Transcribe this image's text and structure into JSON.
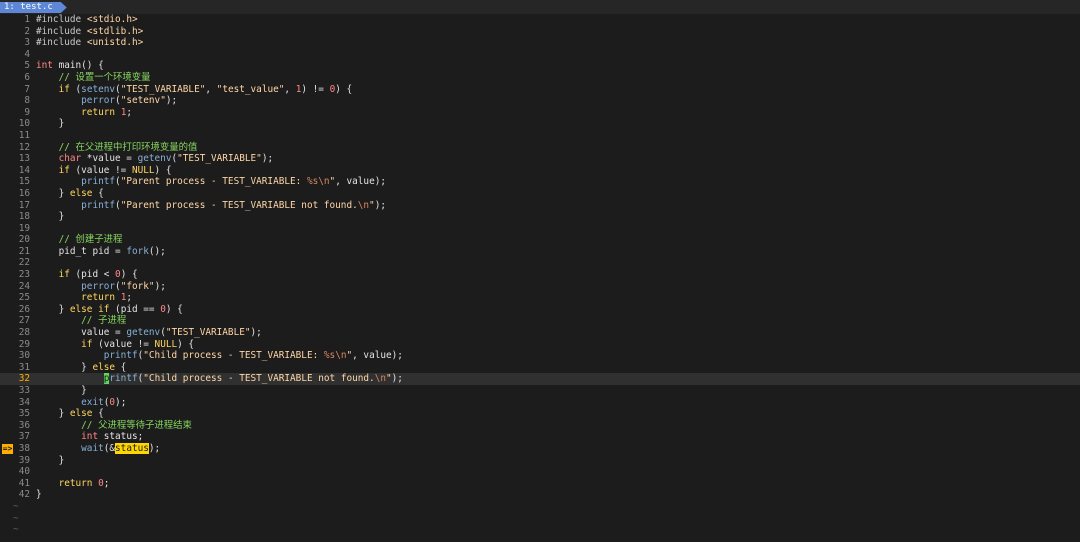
{
  "tab": {
    "label": "1: test.c"
  },
  "editor": {
    "lines": [
      {
        "n": "1",
        "code": "#include <stdio.h>"
      },
      {
        "n": "2",
        "code": "#include <stdlib.h>"
      },
      {
        "n": "3",
        "code": "#include <unistd.h>"
      },
      {
        "n": "4",
        "code": ""
      },
      {
        "n": "5",
        "code": "int main() {"
      },
      {
        "n": "6",
        "code": "    // 设置一个环境变量"
      },
      {
        "n": "7",
        "code": "    if (setenv(\"TEST_VARIABLE\", \"test_value\", 1) != 0) {"
      },
      {
        "n": "8",
        "code": "        perror(\"setenv\");"
      },
      {
        "n": "9",
        "code": "        return 1;"
      },
      {
        "n": "10",
        "code": "    }"
      },
      {
        "n": "11",
        "code": ""
      },
      {
        "n": "12",
        "code": "    // 在父进程中打印环境变量的值"
      },
      {
        "n": "13",
        "code": "    char *value = getenv(\"TEST_VARIABLE\");"
      },
      {
        "n": "14",
        "code": "    if (value != NULL) {"
      },
      {
        "n": "15",
        "code": "        printf(\"Parent process - TEST_VARIABLE: %s\\n\", value);"
      },
      {
        "n": "16",
        "code": "    } else {"
      },
      {
        "n": "17",
        "code": "        printf(\"Parent process - TEST_VARIABLE not found.\\n\");"
      },
      {
        "n": "18",
        "code": "    }"
      },
      {
        "n": "19",
        "code": ""
      },
      {
        "n": "20",
        "code": "    // 创建子进程"
      },
      {
        "n": "21",
        "code": "    pid_t pid = fork();"
      },
      {
        "n": "22",
        "code": ""
      },
      {
        "n": "23",
        "code": "    if (pid < 0) {"
      },
      {
        "n": "24",
        "code": "        perror(\"fork\");"
      },
      {
        "n": "25",
        "code": "        return 1;"
      },
      {
        "n": "26",
        "code": "    } else if (pid == 0) {"
      },
      {
        "n": "27",
        "code": "        // 子进程"
      },
      {
        "n": "28",
        "code": "        value = getenv(\"TEST_VARIABLE\");"
      },
      {
        "n": "29",
        "code": "        if (value != NULL) {"
      },
      {
        "n": "30",
        "code": "            printf(\"Child process - TEST_VARIABLE: %s\\n\", value);"
      },
      {
        "n": "31",
        "code": "        } else {"
      },
      {
        "n": "32",
        "code": "            printf(\"Child process - TEST_VARIABLE not found.\\n\");",
        "current": true
      },
      {
        "n": "33",
        "code": "        }"
      },
      {
        "n": "34",
        "code": "        exit(0);"
      },
      {
        "n": "35",
        "code": "    } else {"
      },
      {
        "n": "36",
        "code": "        // 父进程等待子进程结束"
      },
      {
        "n": "37",
        "code": "        int status;"
      },
      {
        "n": "38",
        "code": "        wait(&status);",
        "sign": "=>"
      },
      {
        "n": "39",
        "code": "    }"
      },
      {
        "n": "40",
        "code": ""
      },
      {
        "n": "41",
        "code": "    return 0;"
      },
      {
        "n": "42",
        "code": "}"
      }
    ],
    "tildes": [
      "~",
      "~",
      "~"
    ]
  },
  "colors": {
    "background": "#1c1c1c",
    "tab_background": "#5f87d7",
    "line_number": "#8a8a8a",
    "current_line_number": "#ffaf00",
    "keyword": "#ffd75f",
    "type": "#ff8787",
    "function": "#87afd7",
    "string": "#ffd7a7",
    "comment": "#87d75f",
    "cursor": "#5fd75f",
    "search_highlight": "#ffd700",
    "sign": "#ffaf00"
  }
}
